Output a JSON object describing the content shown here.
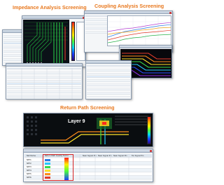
{
  "sections": {
    "impedance": {
      "title": "Impedance Analysis Screening"
    },
    "coupling": {
      "title": "Coupling Analysis Screening"
    },
    "return_path": {
      "title": "Return Path Screening"
    }
  },
  "return_path_view": {
    "layer_label": "Layer 9",
    "table": {
      "headers": [
        "Net Name",
        "Return Path Quality Factor",
        "Near Signal Pin",
        "Near Signal Pin",
        "Near Signal Pin",
        "Far Signal Pin"
      ],
      "net_names": [
        "NET1",
        "NET2",
        "NET3",
        "NET4",
        "NET5",
        "NET6"
      ]
    }
  },
  "colors": {
    "title_orange": "#e8781e",
    "highlight_red": "#d52424",
    "window_border": "#8a9aae"
  },
  "icons": [
    "close-icon"
  ]
}
